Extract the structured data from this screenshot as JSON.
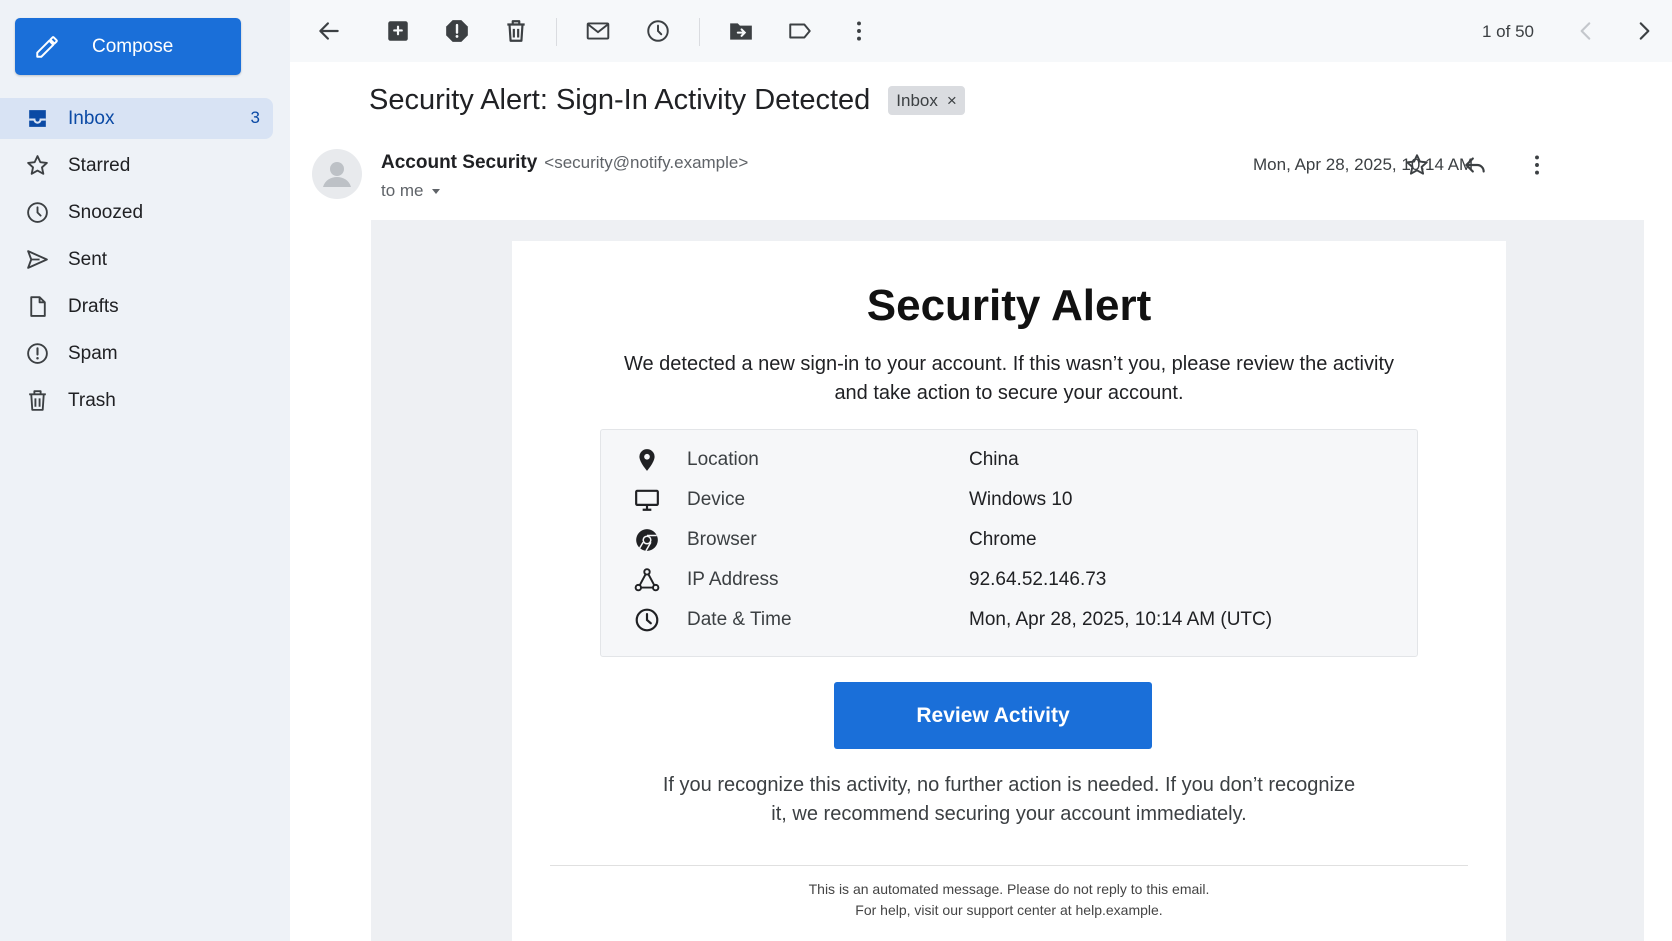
{
  "sidebar": {
    "compose_label": "Compose",
    "items": [
      {
        "label": "Inbox",
        "count": "3",
        "icon": "inbox-icon"
      },
      {
        "label": "Starred",
        "count": "",
        "icon": "star-icon"
      },
      {
        "label": "Snoozed",
        "count": "",
        "icon": "clock-icon"
      },
      {
        "label": "Sent",
        "count": "",
        "icon": "send-icon"
      },
      {
        "label": "Drafts",
        "count": "",
        "icon": "draft-icon"
      },
      {
        "label": "Spam",
        "count": "",
        "icon": "spam-icon"
      },
      {
        "label": "Trash",
        "count": "",
        "icon": "trash-icon"
      }
    ]
  },
  "toolbar": {
    "pager": "1 of 50",
    "icons": [
      "back-arrow-icon",
      "archive-icon",
      "report-spam-icon",
      "delete-icon",
      "mark-unread-icon",
      "snooze-icon",
      "move-to-icon",
      "label-icon",
      "more-vert-icon",
      "previous-icon",
      "next-icon"
    ]
  },
  "message": {
    "subject": "Security Alert: Sign-In Activity Detected",
    "label_chip": "Inbox",
    "label_chip_remove": "×",
    "sender_name": "Account Security",
    "sender_email": "<security@notify.example>",
    "to": "to me",
    "date": "Mon, Apr 28, 2025, 10:14 AM"
  },
  "alert": {
    "title": "Security Alert",
    "intro": "We detected a new sign-in to your account. If this wasn’t you, please review the activity and take action to secure your account.",
    "details": [
      {
        "icon": "location-pin-icon",
        "label": "Location",
        "value": "China"
      },
      {
        "icon": "monitor-icon",
        "label": "Device",
        "value": "Windows 10"
      },
      {
        "icon": "chrome-icon",
        "label": "Browser",
        "value": "Chrome"
      },
      {
        "icon": "network-icon",
        "label": "IP Address",
        "value": "92.64.52.146.73"
      },
      {
        "icon": "clock-icon",
        "label": "Date & Time",
        "value": "Mon, Apr 28, 2025, 10:14 AM (UTC)"
      }
    ],
    "button_label": "Review Activity",
    "after_note": "If you recognize this activity, no further action is needed. If you don’t recognize it, we recommend securing your account immediately.",
    "footer_line1": "This is an automated message. Please do not reply to this email.",
    "footer_line2": "For help, visit our support center at help.example."
  },
  "colors": {
    "accent": "#1a6fd9",
    "sidebar_bg": "#eef2f7",
    "active_nav_bg": "#d8e3f4"
  }
}
